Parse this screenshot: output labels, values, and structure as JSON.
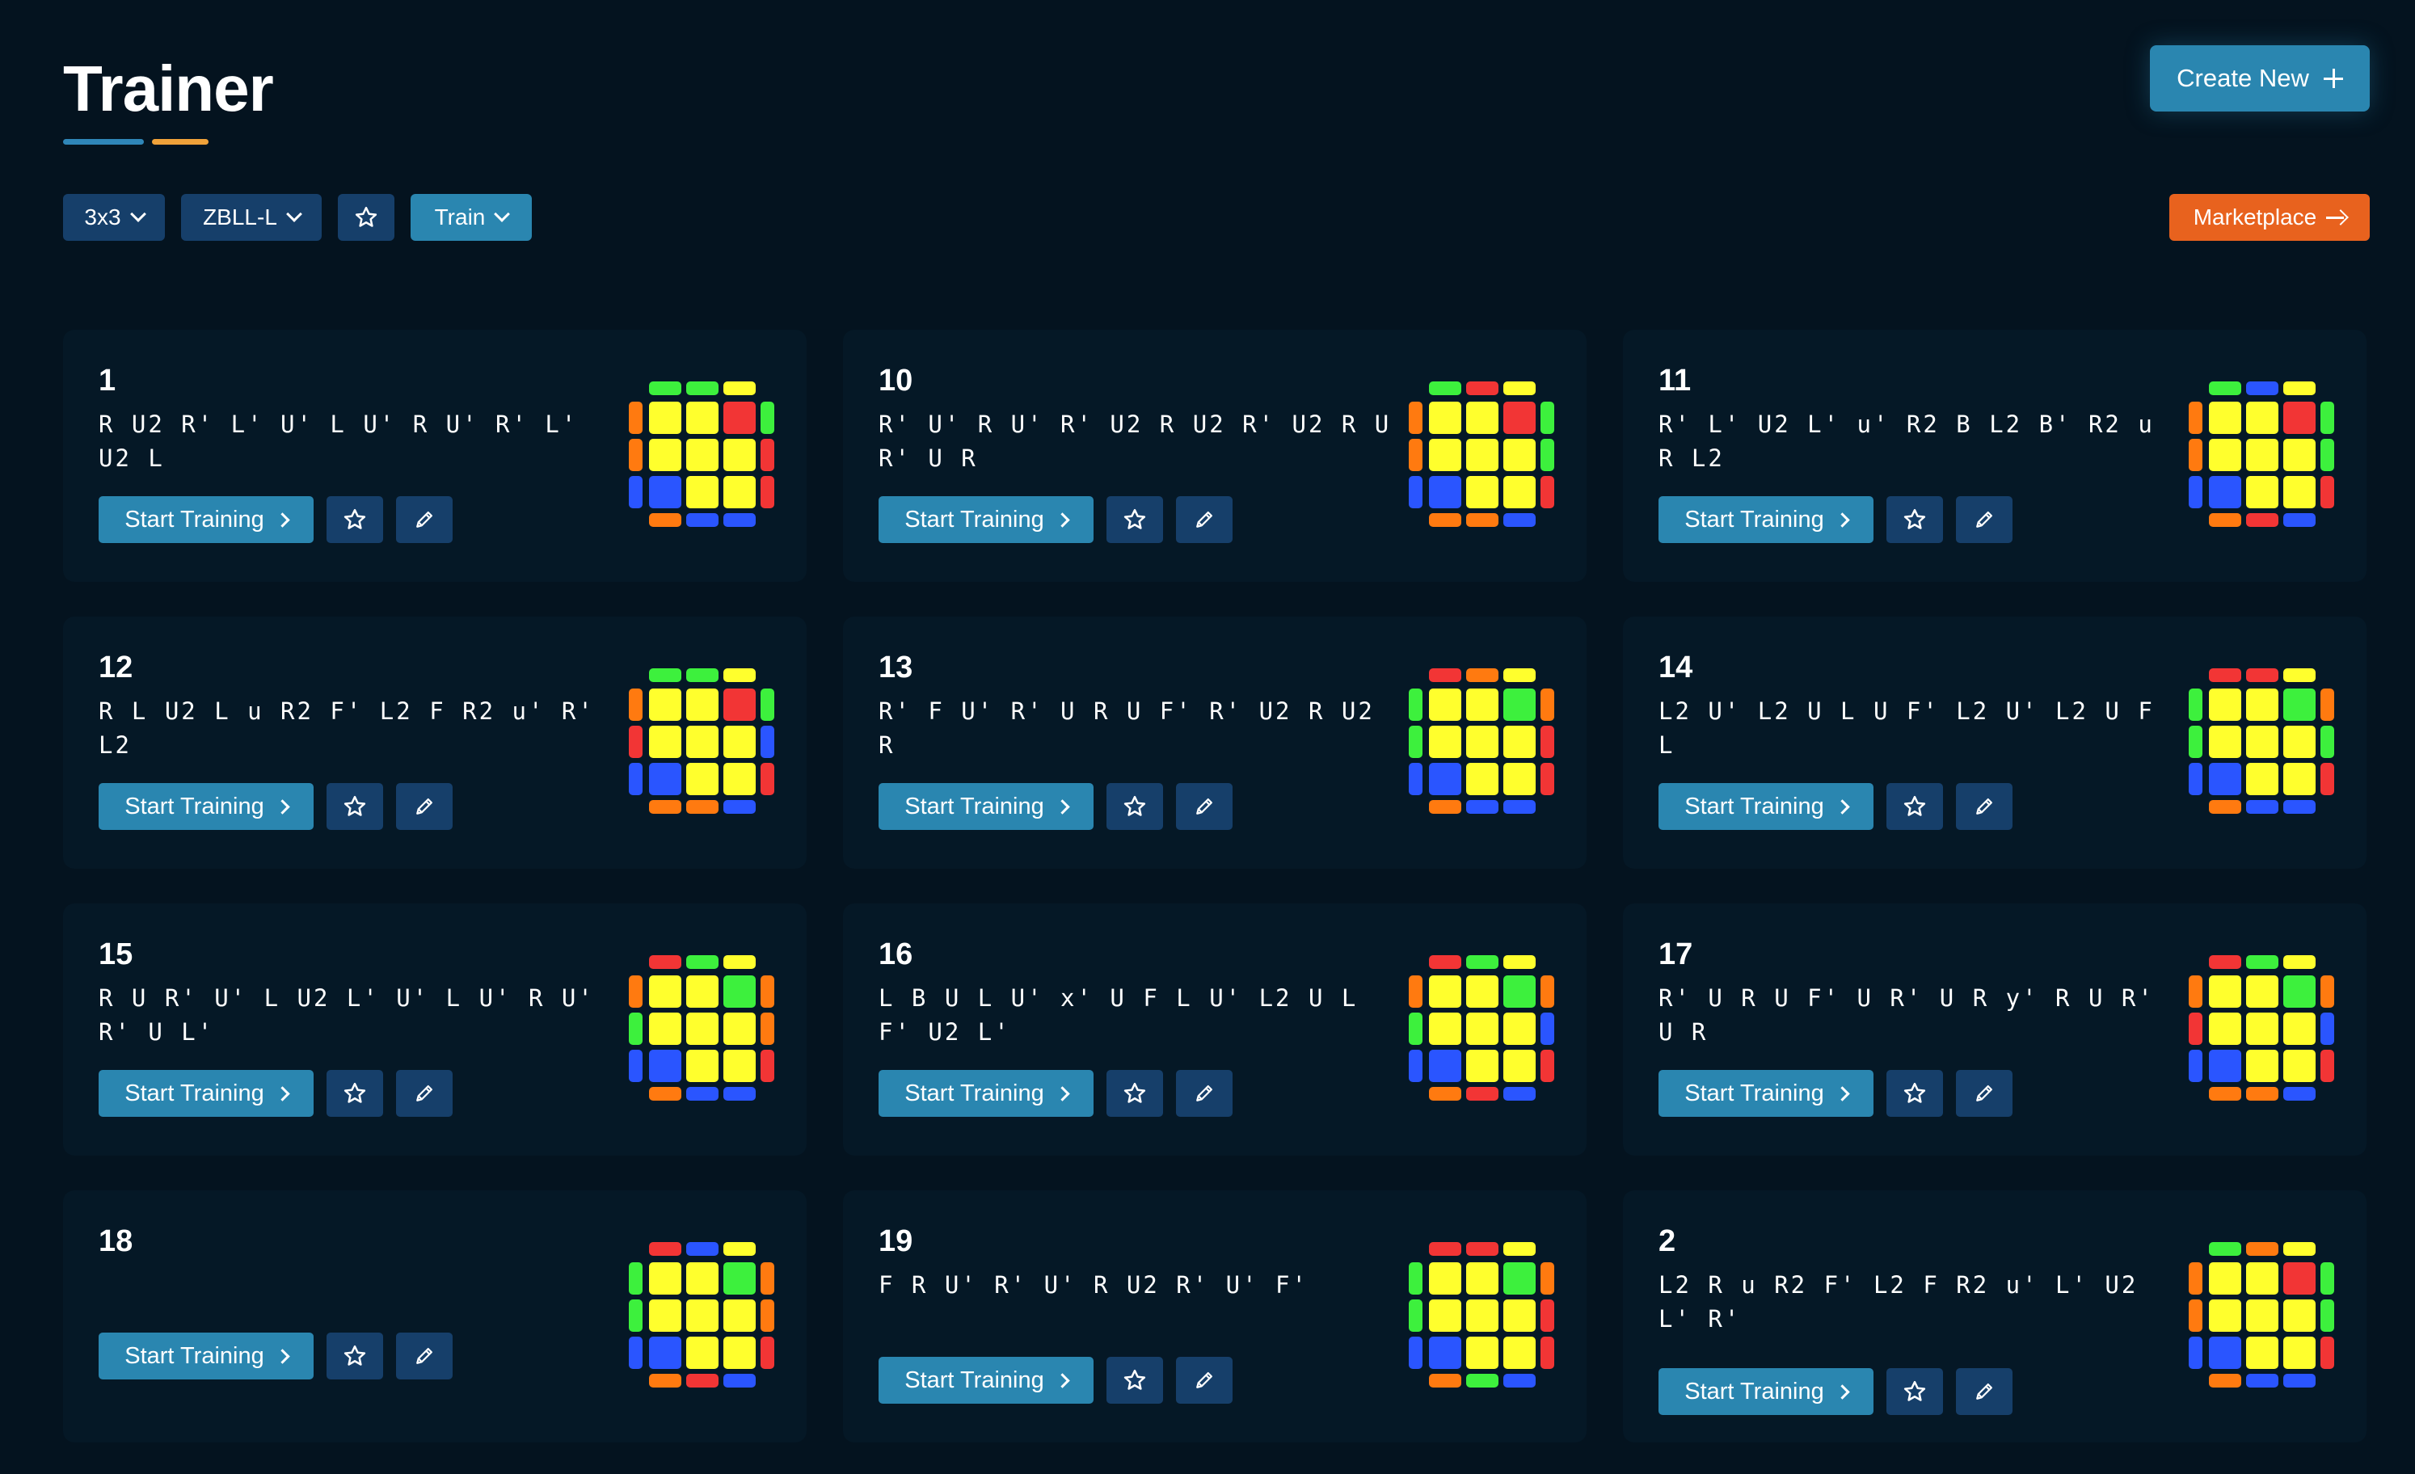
{
  "header": {
    "title": "Trainer",
    "create_label": "Create New"
  },
  "filters": {
    "puzzle": "3x3",
    "set": "ZBLL-L",
    "mode": "Train"
  },
  "marketplace_label": "Marketplace",
  "colors": {
    "background": "#04131f",
    "card": "#051826",
    "primary": "#2a86b0",
    "secondary": "#163f6a",
    "accent_orange": "#e8621e",
    "sticker_yellow": "#ffff2d",
    "sticker_red": "#f23535",
    "sticker_green": "#3df03d",
    "sticker_blue": "#2a55ff",
    "sticker_orange": "#ff7a10"
  },
  "card_actions": {
    "start_label": "Start Training",
    "favorite_icon": "star-icon",
    "edit_icon": "pencil-icon"
  },
  "cases": [
    {
      "id": "1",
      "alg": "R U2 R' L' U' L U' R U' R' L' U2 L",
      "cube": {
        "top": [
          "G",
          "G",
          "Y"
        ],
        "left": [
          "O",
          "O",
          "B"
        ],
        "right": [
          "G",
          "R",
          "R"
        ],
        "bottom": [
          "O",
          "B",
          "B"
        ],
        "grid": [
          [
            "Y",
            "Y",
            "R"
          ],
          [
            "Y",
            "Y",
            "Y"
          ],
          [
            "B",
            "Y",
            "Y"
          ]
        ]
      }
    },
    {
      "id": "10",
      "alg": "R' U' R U' R' U2 R U2 R' U2 R U R' U R",
      "cube": {
        "top": [
          "G",
          "R",
          "Y"
        ],
        "left": [
          "O",
          "O",
          "B"
        ],
        "right": [
          "G",
          "G",
          "R"
        ],
        "bottom": [
          "O",
          "O",
          "B"
        ],
        "grid": [
          [
            "Y",
            "Y",
            "R"
          ],
          [
            "Y",
            "Y",
            "Y"
          ],
          [
            "B",
            "Y",
            "Y"
          ]
        ]
      }
    },
    {
      "id": "11",
      "alg": "R' L' U2 L' u' R2 B L2 B' R2 u R L2",
      "cube": {
        "top": [
          "G",
          "B",
          "Y"
        ],
        "left": [
          "O",
          "O",
          "B"
        ],
        "right": [
          "G",
          "G",
          "R"
        ],
        "bottom": [
          "O",
          "R",
          "B"
        ],
        "grid": [
          [
            "Y",
            "Y",
            "R"
          ],
          [
            "Y",
            "Y",
            "Y"
          ],
          [
            "B",
            "Y",
            "Y"
          ]
        ]
      }
    },
    {
      "id": "12",
      "alg": "R L U2 L u R2 F' L2 F R2 u' R' L2",
      "cube": {
        "top": [
          "G",
          "G",
          "Y"
        ],
        "left": [
          "O",
          "R",
          "B"
        ],
        "right": [
          "G",
          "B",
          "R"
        ],
        "bottom": [
          "O",
          "O",
          "B"
        ],
        "grid": [
          [
            "Y",
            "Y",
            "R"
          ],
          [
            "Y",
            "Y",
            "Y"
          ],
          [
            "B",
            "Y",
            "Y"
          ]
        ]
      }
    },
    {
      "id": "13",
      "alg": "R' F U' R' U R U F' R' U2 R U2 R",
      "cube": {
        "top": [
          "R",
          "O",
          "Y"
        ],
        "left": [
          "G",
          "G",
          "B"
        ],
        "right": [
          "O",
          "R",
          "R"
        ],
        "bottom": [
          "O",
          "B",
          "B"
        ],
        "grid": [
          [
            "Y",
            "Y",
            "G"
          ],
          [
            "Y",
            "Y",
            "Y"
          ],
          [
            "B",
            "Y",
            "Y"
          ]
        ]
      }
    },
    {
      "id": "14",
      "alg": "L2 U' L2 U L U F' L2 U' L2 U F L",
      "cube": {
        "top": [
          "R",
          "R",
          "Y"
        ],
        "left": [
          "G",
          "G",
          "B"
        ],
        "right": [
          "O",
          "G",
          "R"
        ],
        "bottom": [
          "O",
          "B",
          "B"
        ],
        "grid": [
          [
            "Y",
            "Y",
            "G"
          ],
          [
            "Y",
            "Y",
            "Y"
          ],
          [
            "B",
            "Y",
            "Y"
          ]
        ]
      }
    },
    {
      "id": "15",
      "alg": "R U R' U' L U2 L' U' L U' R U' R' U L'",
      "cube": {
        "top": [
          "R",
          "G",
          "Y"
        ],
        "left": [
          "O",
          "G",
          "B"
        ],
        "right": [
          "O",
          "O",
          "R"
        ],
        "bottom": [
          "O",
          "B",
          "B"
        ],
        "grid": [
          [
            "Y",
            "Y",
            "G"
          ],
          [
            "Y",
            "Y",
            "Y"
          ],
          [
            "B",
            "Y",
            "Y"
          ]
        ]
      }
    },
    {
      "id": "16",
      "alg": "L B U L U' x' U F L U' L2 U L F' U2 L'",
      "cube": {
        "top": [
          "R",
          "G",
          "Y"
        ],
        "left": [
          "O",
          "G",
          "B"
        ],
        "right": [
          "O",
          "B",
          "R"
        ],
        "bottom": [
          "O",
          "R",
          "B"
        ],
        "grid": [
          [
            "Y",
            "Y",
            "G"
          ],
          [
            "Y",
            "Y",
            "Y"
          ],
          [
            "B",
            "Y",
            "Y"
          ]
        ]
      }
    },
    {
      "id": "17",
      "alg": "R' U R U F' U R' U R y' R U R' U R",
      "cube": {
        "top": [
          "R",
          "G",
          "Y"
        ],
        "left": [
          "O",
          "R",
          "B"
        ],
        "right": [
          "O",
          "B",
          "R"
        ],
        "bottom": [
          "O",
          "O",
          "B"
        ],
        "grid": [
          [
            "Y",
            "Y",
            "G"
          ],
          [
            "Y",
            "Y",
            "Y"
          ],
          [
            "B",
            "Y",
            "Y"
          ]
        ]
      }
    },
    {
      "id": "18",
      "alg": "",
      "cube": {
        "top": [
          "R",
          "B",
          "Y"
        ],
        "left": [
          "G",
          "G",
          "B"
        ],
        "right": [
          "O",
          "O",
          "R"
        ],
        "bottom": [
          "O",
          "R",
          "B"
        ],
        "grid": [
          [
            "Y",
            "Y",
            "G"
          ],
          [
            "Y",
            "Y",
            "Y"
          ],
          [
            "B",
            "Y",
            "Y"
          ]
        ]
      }
    },
    {
      "id": "19",
      "alg": "F R U' R' U' R U2 R' U' F'",
      "cube": {
        "top": [
          "R",
          "R",
          "Y"
        ],
        "left": [
          "G",
          "G",
          "B"
        ],
        "right": [
          "O",
          "R",
          "R"
        ],
        "bottom": [
          "O",
          "G",
          "B"
        ],
        "grid": [
          [
            "Y",
            "Y",
            "G"
          ],
          [
            "Y",
            "Y",
            "Y"
          ],
          [
            "B",
            "Y",
            "Y"
          ]
        ]
      }
    },
    {
      "id": "2",
      "alg": "L2 R u R2 F' L2 F R2 u' L' U2 L' R'",
      "cube": {
        "top": [
          "G",
          "O",
          "Y"
        ],
        "left": [
          "O",
          "O",
          "B"
        ],
        "right": [
          "G",
          "G",
          "R"
        ],
        "bottom": [
          "O",
          "B",
          "B"
        ],
        "grid": [
          [
            "Y",
            "Y",
            "R"
          ],
          [
            "Y",
            "Y",
            "Y"
          ],
          [
            "B",
            "Y",
            "Y"
          ]
        ]
      }
    }
  ]
}
